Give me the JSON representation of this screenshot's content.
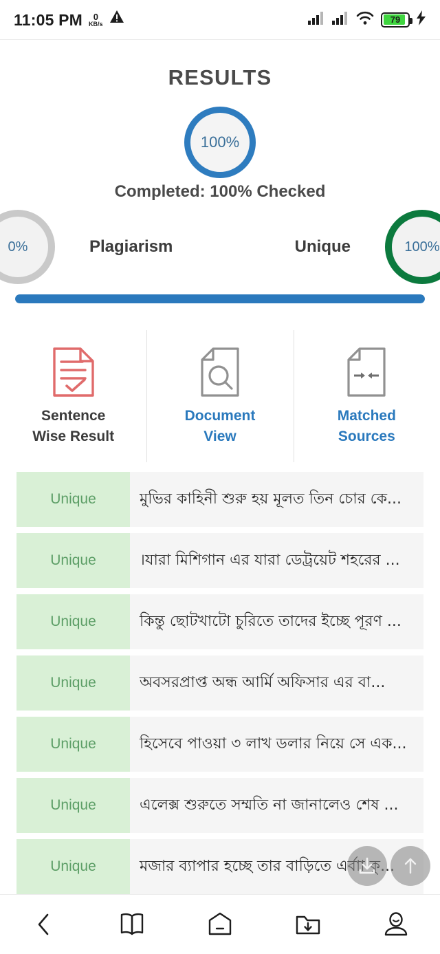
{
  "status_bar": {
    "time": "11:05 PM",
    "net_speed_value": "0",
    "net_speed_unit": "KB/s",
    "warning_icon": "warning-triangle-icon",
    "signal_1_icon": "signal-bars-icon",
    "signal_2_icon": "signal-bars-icon",
    "wifi_icon": "wifi-icon",
    "battery_level": "79",
    "battery_color": "#3fd53f",
    "charging_icon": "lightning-bolt-icon"
  },
  "header": {
    "title": "RESULTS"
  },
  "main_gauge": {
    "value": "100%",
    "ring_color": "#2e7cbf",
    "text_color": "#3a6f99"
  },
  "completed_text": "Completed: 100% Checked",
  "gauges": {
    "plagiarism": {
      "value": "0%",
      "label": "Plagiarism",
      "ring_color": "#c9c9c9"
    },
    "unique": {
      "value": "100%",
      "label": "Unique",
      "ring_color": "#0c7a3e"
    }
  },
  "progress": {
    "percent": 100,
    "fill_color": "#2a79bd"
  },
  "tabs": [
    {
      "label_line1": "Sentence",
      "label_line2": "Wise Result",
      "icon": "document-check-icon",
      "active": true,
      "icon_color": "#e06b6b"
    },
    {
      "label_line1": "Document",
      "label_line2": "View",
      "icon": "document-search-icon",
      "active": false,
      "icon_color": "#919191"
    },
    {
      "label_line1": "Matched",
      "label_line2": "Sources",
      "icon": "document-arrows-icon",
      "active": false,
      "icon_color": "#919191"
    }
  ],
  "sentences": [
    {
      "status": "Unique",
      "text": "মুভির কাহিনী শুরু হয় মূলত তিন চোর কে..."
    },
    {
      "status": "Unique",
      "text": "।যারা মিশিগান এর যারা ডেট্রয়েট শহরের ..."
    },
    {
      "status": "Unique",
      "text": "কিন্তু ছোটখাটো চুরিতে তাদের ইচ্ছে পূরণ ..."
    },
    {
      "status": "Unique",
      "text": "অবসরপ্রাপ্ত অন্ধ আর্মি অফিসার এর বা..."
    },
    {
      "status": "Unique",
      "text": "হিসেবে পাওয়া ৩ লাখ ডলার নিয়ে সে এক..."
    },
    {
      "status": "Unique",
      "text": "এলেক্স শুরুতে সম্মতি না জানালেও শেষ ..."
    },
    {
      "status": "Unique",
      "text": "মজার ব্যাপার হচ্ছে তার বাড়িতে এর্বাা কু..."
    }
  ],
  "badge_colors": {
    "background": "#d9f0d6",
    "text": "#5c9e66"
  },
  "fabs": [
    {
      "icon": "save-download-icon"
    },
    {
      "icon": "scroll-to-top-arrow-icon"
    }
  ],
  "bottom_nav": [
    {
      "icon": "back-chevron-icon"
    },
    {
      "icon": "open-book-icon"
    },
    {
      "icon": "home-icon"
    },
    {
      "icon": "download-folder-icon"
    },
    {
      "icon": "account-person-icon"
    }
  ]
}
